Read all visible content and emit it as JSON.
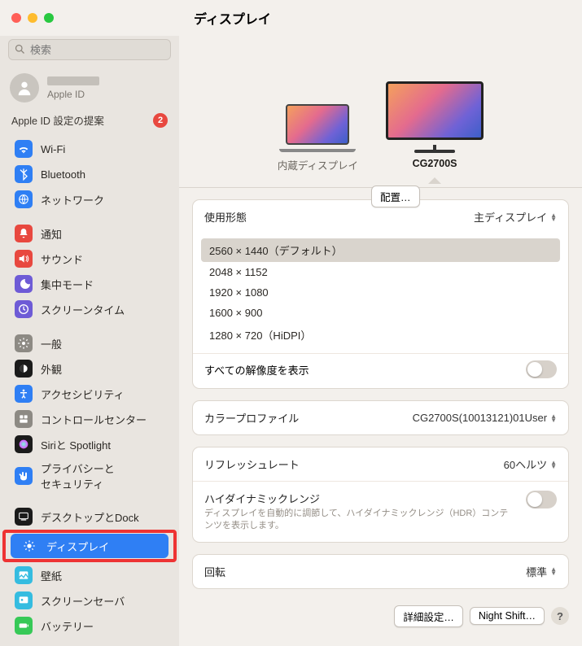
{
  "header": {
    "title": "ディスプレイ"
  },
  "search": {
    "placeholder": "検索"
  },
  "apple_id": {
    "sub": "Apple ID"
  },
  "suggest": {
    "label": "Apple ID 設定の提案",
    "badge": "2"
  },
  "sidebar_groups": [
    [
      "Wi-Fi",
      "Bluetooth",
      "ネットワーク"
    ],
    [
      "通知",
      "サウンド",
      "集中モード",
      "スクリーンタイム"
    ],
    [
      "一般",
      "外観",
      "アクセシビリティ",
      "コントロールセンター",
      "Siriと Spotlight",
      "プライバシーと\nセキュリティ"
    ],
    [
      "デスクトップとDock",
      "ディスプレイ",
      "壁紙",
      "スクリーンセーバ",
      "バッテリー"
    ]
  ],
  "sidebar_icons": {
    "Wi-Fi": {
      "bg": "#2f7ff4",
      "svg": "wifi"
    },
    "Bluetooth": {
      "bg": "#2f7ff4",
      "svg": "bt"
    },
    "ネットワーク": {
      "bg": "#2f7ff4",
      "svg": "globe"
    },
    "通知": {
      "bg": "#e8483f",
      "svg": "bell"
    },
    "サウンド": {
      "bg": "#e8483f",
      "svg": "sound"
    },
    "集中モード": {
      "bg": "#6e5bd6",
      "svg": "moon"
    },
    "スクリーンタイム": {
      "bg": "#6e5bd6",
      "svg": "hour"
    },
    "一般": {
      "bg": "#8d8a84",
      "svg": "gear"
    },
    "外観": {
      "bg": "#1b1b1b",
      "svg": "appear"
    },
    "アクセシビリティ": {
      "bg": "#2f7ff4",
      "svg": "acc"
    },
    "コントロールセンター": {
      "bg": "#8d8a84",
      "svg": "cc"
    },
    "Siriと Spotlight": {
      "bg": "#1b1b1b",
      "svg": "siri"
    },
    "プライバシーと\nセキュリティ": {
      "bg": "#2f7ff4",
      "svg": "hand"
    },
    "デスクトップとDock": {
      "bg": "#1b1b1b",
      "svg": "dock"
    },
    "ディスプレイ": {
      "bg": "#2f7ff4",
      "svg": "sun"
    },
    "壁紙": {
      "bg": "#35bce0",
      "svg": "wall"
    },
    "スクリーンセーバ": {
      "bg": "#35bce0",
      "svg": "ss"
    },
    "バッテリー": {
      "bg": "#37c957",
      "svg": "batt"
    }
  },
  "sidebar_active": "ディスプレイ",
  "arrange_button": "配置…",
  "monitors": {
    "internal": "内蔵ディスプレイ",
    "external": "CG2700S",
    "selected": "external"
  },
  "usage": {
    "label": "使用形態",
    "value": "主ディスプレイ"
  },
  "resolutions": [
    "2560 × 1440（デフォルト）",
    "2048 × 1152",
    "1920 × 1080",
    "1600 × 900",
    "1280 × 720（HiDPI）"
  ],
  "resolution_selected": 0,
  "show_all": "すべての解像度を表示",
  "color": {
    "label": "カラープロファイル",
    "value": "CG2700S(10013121)01User"
  },
  "refresh": {
    "label": "リフレッシュレート",
    "value": "60ヘルツ"
  },
  "hdr": {
    "label": "ハイダイナミックレンジ",
    "desc": "ディスプレイを自動的に調節して、ハイダイナミックレンジ（HDR）コンテンツを表示します。"
  },
  "rotation": {
    "label": "回転",
    "value": "標準"
  },
  "footer": {
    "advanced": "詳細設定…",
    "nightshift": "Night Shift…",
    "help": "?"
  }
}
